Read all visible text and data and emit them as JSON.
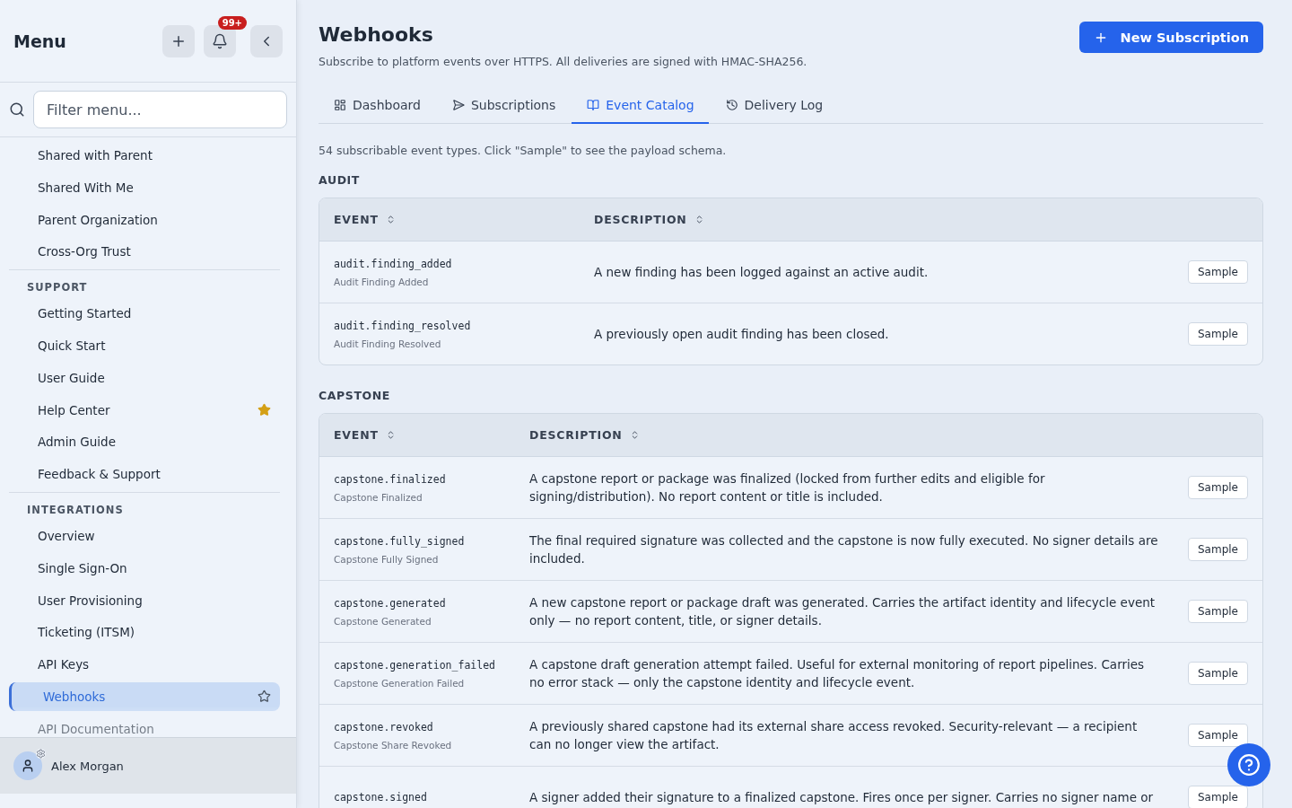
{
  "sidebar": {
    "title": "Menu",
    "notification_count": "99+",
    "filter": {
      "placeholder": "Filter menu..."
    },
    "sections": [
      {
        "items": [
          {
            "label": "Shared with Parent",
            "selected": false
          },
          {
            "label": "Shared With Me",
            "selected": false
          },
          {
            "label": "Parent Organization",
            "selected": false
          },
          {
            "label": "Cross-Org Trust",
            "selected": false
          }
        ]
      },
      {
        "heading": "SUPPORT",
        "items": [
          {
            "label": "Getting Started",
            "selected": false
          },
          {
            "label": "Quick Start",
            "selected": false
          },
          {
            "label": "User Guide",
            "selected": false
          },
          {
            "label": "Help Center",
            "selected": false,
            "favorite": true
          },
          {
            "label": "Admin Guide",
            "selected": false
          },
          {
            "label": "Feedback & Support",
            "selected": false
          }
        ]
      },
      {
        "heading": "INTEGRATIONS",
        "items": [
          {
            "label": "Overview",
            "selected": false
          },
          {
            "label": "Single Sign-On",
            "selected": false
          },
          {
            "label": "User Provisioning",
            "selected": false
          },
          {
            "label": "Ticketing (ITSM)",
            "selected": false
          },
          {
            "label": "API Keys",
            "selected": false
          },
          {
            "label": "Webhooks",
            "selected": true,
            "favorite": false
          },
          {
            "label": "API Documentation",
            "selected": false
          }
        ]
      }
    ],
    "user": {
      "name": "Alex Morgan"
    }
  },
  "page": {
    "title": "Webhooks",
    "subtitle": "Subscribe to platform events over HTTPS. All deliveries are signed with HMAC-SHA256.",
    "action": "New Subscription"
  },
  "tabs": [
    {
      "label": "Dashboard",
      "selected": false
    },
    {
      "label": "Subscriptions",
      "selected": false
    },
    {
      "label": "Event Catalog",
      "selected": true
    },
    {
      "label": "Delivery Log",
      "selected": false
    }
  ],
  "intro": "54 subscribable event types. Click \"Sample\" to see the payload schema.",
  "groups": [
    {
      "name": "AUDIT",
      "columns": [
        "EVENT",
        "DESCRIPTION"
      ],
      "rows": [
        {
          "event": "audit.finding_added",
          "label": "Audit Finding Added",
          "description": "A new finding has been logged against an active audit.",
          "button": "Sample"
        },
        {
          "event": "audit.finding_resolved",
          "label": "Audit Finding Resolved",
          "description": "A previously open audit finding has been closed.",
          "button": "Sample"
        }
      ]
    },
    {
      "name": "CAPSTONE",
      "columns": [
        "EVENT",
        "DESCRIPTION"
      ],
      "rows": [
        {
          "event": "capstone.finalized",
          "label": "Capstone Finalized",
          "description": "A capstone report or package was finalized (locked from further edits and eligible for signing/distribution). No report content or title is included.",
          "button": "Sample"
        },
        {
          "event": "capstone.fully_signed",
          "label": "Capstone Fully Signed",
          "description": "The final required signature was collected and the capstone is now fully executed. No signer details are included.",
          "button": "Sample"
        },
        {
          "event": "capstone.generated",
          "label": "Capstone Generated",
          "description": "A new capstone report or package draft was generated. Carries the artifact identity and lifecycle event only — no report content, title, or signer details.",
          "button": "Sample"
        },
        {
          "event": "capstone.generation_failed",
          "label": "Capstone Generation Failed",
          "description": "A capstone draft generation attempt failed. Useful for external monitoring of report pipelines. Carries no error stack — only the capstone identity and lifecycle event.",
          "button": "Sample"
        },
        {
          "event": "capstone.revoked",
          "label": "Capstone Share Revoked",
          "description": "A previously shared capstone had its external share access revoked. Security-relevant — a recipient can no longer view the artifact.",
          "button": "Sample"
        },
        {
          "event": "capstone.signed",
          "description": "A signer added their signature to a finalized capstone. Fires once per signer. Carries no signer name or",
          "button": "Sample"
        }
      ]
    }
  ]
}
